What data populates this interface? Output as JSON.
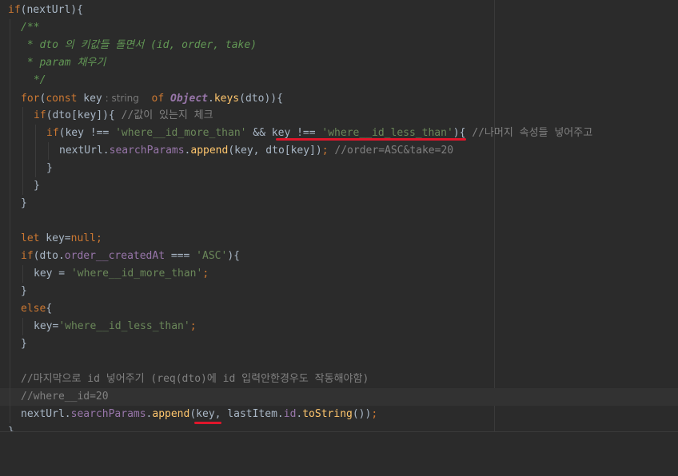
{
  "code": {
    "l1_if": "if",
    "l1_rest": "(nextUrl){",
    "l2": "/**",
    "l3": " * dto 의 키값들 돌면서 (id, order, take)",
    "l4": " * param 채우기",
    "l5": " */",
    "l6_for": "for",
    "l6_paren": "(",
    "l6_const": "const",
    "l6_key": " key",
    "l6_hint": " : string",
    "l6_of": "of",
    "l6_object": "Object",
    "l6_dot": ".",
    "l6_keys": "keys",
    "l6_end": "(dto)){",
    "l7_if": "if",
    "l7_rest": "(dto[key]){ ",
    "l7_cmt": "//값이 있는지 체크",
    "l8_if": "if",
    "l8_a": "(key !== ",
    "l8_s1": "'where__id_more_than'",
    "l8_b": " && key !== ",
    "l8_s2": "'where__id_less_than'",
    "l8_c": "){ ",
    "l8_cmt": "//나머지 속성들 넣어주고",
    "l9_a": "nextUrl.",
    "l9_prop": "searchParams",
    "l9_dot": ".",
    "l9_fn": "append",
    "l9_b": "(key, dto[key])",
    "l9_semi": ";",
    "l9_cmt": " //order=ASC&take=20",
    "l10": "}",
    "l11": "}",
    "l12": "}",
    "l14_let": "let",
    "l14_a": " key=",
    "l14_null": "null",
    "l14_semi": ";",
    "l15_if": "if",
    "l15_a": "(dto.",
    "l15_prop": "order__createdAt",
    "l15_b": " === ",
    "l15_s": "'ASC'",
    "l15_c": "){",
    "l16_a": "key = ",
    "l16_s": "'where__id_more_than'",
    "l16_semi": ";",
    "l17": "}",
    "l18_else": "else",
    "l18_b": "{",
    "l19_a": "key=",
    "l19_s": "'where__id_less_than'",
    "l19_semi": ";",
    "l20": "}",
    "l22": "//마지막으로 id 넣어주기 (req(dto)에 id 입력안한경우도 작동해야함)",
    "l23": "//where__id=20",
    "l24_a": "nextUrl.",
    "l24_prop": "searchParams",
    "l24_dot": ".",
    "l24_fn": "append",
    "l24_b": "(key, lastItem.",
    "l24_prop2": "id",
    "l24_dot2": ".",
    "l24_fn2": "toString",
    "l24_c": "())",
    "l24_semi": ";",
    "l25": "}"
  },
  "colors": {
    "background": "#2b2b2b",
    "keyword": "#cc7832",
    "string": "#6a8759",
    "comment": "#808080",
    "doc_comment": "#629755",
    "property": "#9876aa",
    "function": "#ffc66d",
    "default_text": "#a9b7c6",
    "annotation_underline": "#e0162b"
  }
}
